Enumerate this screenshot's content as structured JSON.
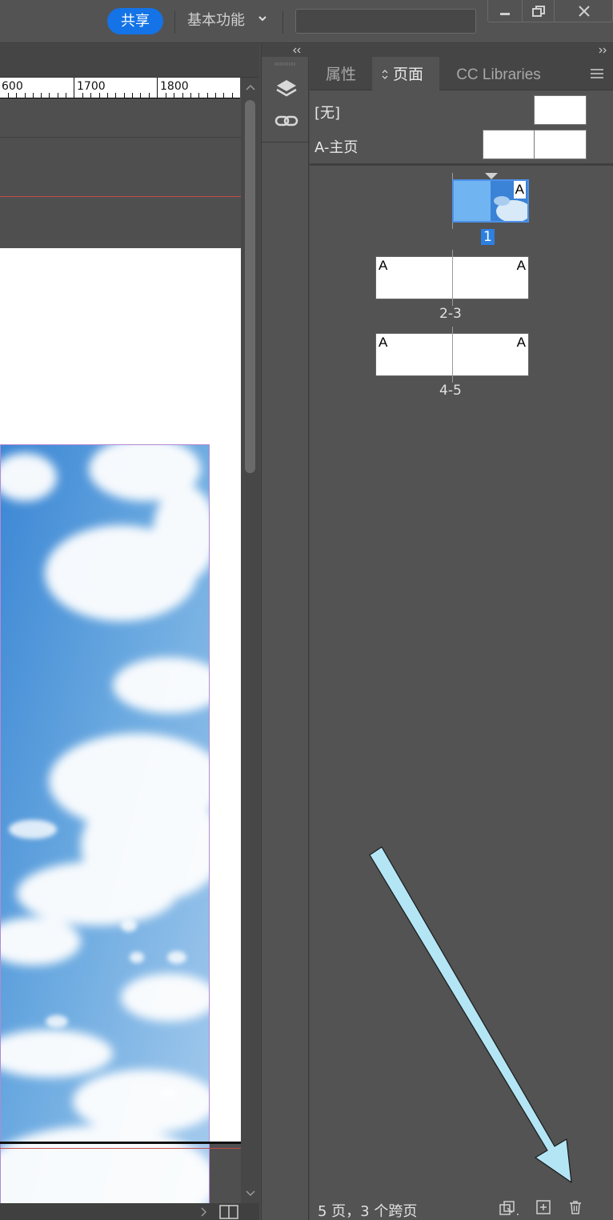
{
  "topbar": {
    "share_label": "共享",
    "workspace_label": "基本功能",
    "search": {
      "value": "",
      "placeholder": ""
    },
    "window_buttons": [
      "minimize-icon",
      "restore-icon",
      "close-icon"
    ]
  },
  "ruler": {
    "labels": [
      "600",
      "1700",
      "1800"
    ]
  },
  "icon_strip": {
    "items": [
      "layers-icon",
      "links-icon"
    ]
  },
  "panel": {
    "tabs": [
      {
        "label": "属性",
        "active": false
      },
      {
        "label": "页面",
        "active": true
      },
      {
        "label": "CC Libraries",
        "active": false
      }
    ],
    "masters": [
      {
        "name": "[无]"
      },
      {
        "name": "A-主页"
      }
    ],
    "pages": [
      {
        "label": "1",
        "selected": true,
        "master_marks": [
          "A"
        ]
      },
      {
        "label": "2-3",
        "selected": false,
        "master_marks": [
          "A",
          "A"
        ]
      },
      {
        "label": "4-5",
        "selected": false,
        "master_marks": [
          "A",
          "A"
        ]
      }
    ],
    "footer_text": "5 页，3 个跨页",
    "footer_buttons": [
      "edit-page-size-icon",
      "new-page-icon",
      "delete-page-icon"
    ]
  },
  "colors": {
    "accent": "#1473e6",
    "selected_page": "#2d7fe0",
    "annotation_arrow": "#b3e5f5"
  }
}
